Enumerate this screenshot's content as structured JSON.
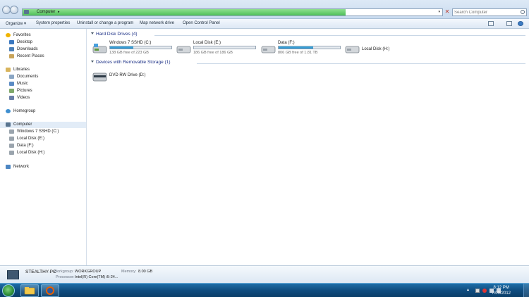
{
  "window": {
    "address": {
      "segment": "Computer",
      "arrow": "▸"
    },
    "search": {
      "placeholder": "Search Computer"
    }
  },
  "toolbar": {
    "organize": "Organize ▾",
    "system_properties": "System properties",
    "uninstall": "Uninstall or change a program",
    "map_network_drive": "Map network drive",
    "open_control_panel": "Open Control Panel"
  },
  "nav": {
    "favorites": "Favorites",
    "desktop": "Desktop",
    "downloads": "Downloads",
    "recent_places": "Recent Places",
    "libraries": "Libraries",
    "documents": "Documents",
    "music": "Music",
    "pictures": "Pictures",
    "videos": "Videos",
    "homegroup": "Homegroup",
    "computer": "Computer",
    "computer_items": [
      "Windows 7 SSHD (C:)",
      "Local Disk (E:)",
      "Data (F:)",
      "Local Disk (H:)"
    ],
    "network": "Network"
  },
  "content": {
    "hard_disk_header": "Hard Disk Drives (4)",
    "removable_header": "Devices with Removable Storage (1)",
    "drives": [
      {
        "name": "Windows 7 SSHD (C:)",
        "free": "138 GB free of 223 GB",
        "used_fraction": 0.38
      },
      {
        "name": "Local Disk (E:)",
        "free": "186 GB free of 186 GB",
        "used_fraction": 0.0
      },
      {
        "name": "Data (F:)",
        "free": "806 GB free of 1.81 TB",
        "used_fraction": 0.56
      },
      {
        "name": "Local Disk (H:)"
      }
    ],
    "dvd": {
      "name": "DVD RW Drive (D:)"
    }
  },
  "details": {
    "pc_name": "STEALTHY-PC",
    "workgroup_label": "Workgroup:",
    "workgroup_value": "WORKGROUP",
    "memory_label": "Memory:",
    "memory_value": "8.00 GB",
    "processor_label": "Processor:",
    "processor_value": "Intel(R) Core(TM) i5-24..."
  },
  "taskbar": {
    "time": "8:12 PM",
    "date": "7/09/2012"
  },
  "colors": {
    "accent_header": "#1e3287",
    "drive_bar": "#1f86c6",
    "address_progress": "#4fbf5a",
    "taskbar": "#0f4d80"
  }
}
